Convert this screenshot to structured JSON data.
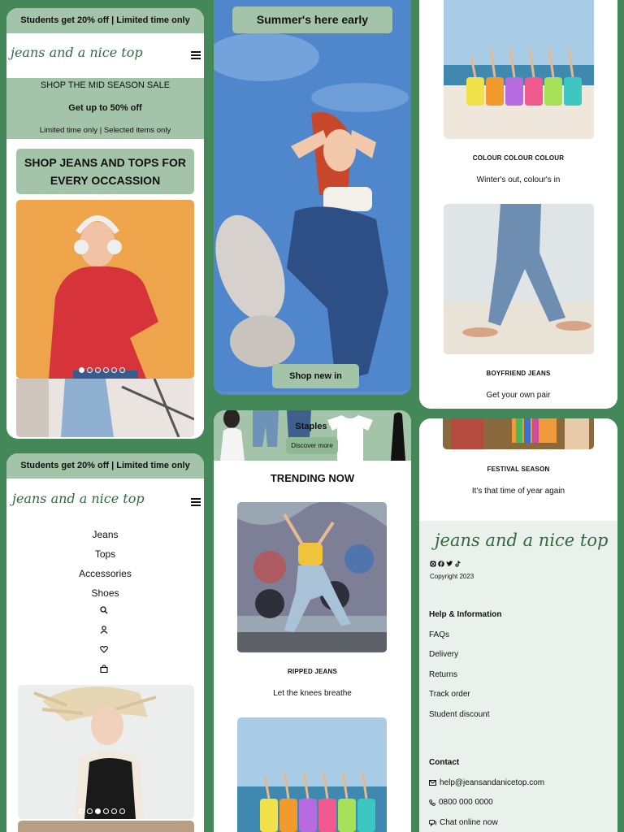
{
  "promo": "Students get 20% off | Limited time only",
  "brand": "jeans and a nice top",
  "sale": {
    "title": "SHOP THE MID SEASON SALE",
    "offer": "Get up to 50% off",
    "note": "Limited time only | Selected items only"
  },
  "hero_heading": "SHOP JEANS AND TOPS FOR EVERY OCCASSION",
  "carousel1": {
    "slides": 6,
    "active": 1
  },
  "summer": {
    "banner": "Summer's here early",
    "cta": "Shop new in"
  },
  "staples": {
    "title": "Staples",
    "cta": "Discover more"
  },
  "trending": {
    "heading": "TRENDING NOW",
    "items": [
      {
        "title": "RIPPED JEANS",
        "subtitle": "Let the knees breathe"
      }
    ]
  },
  "collections": [
    {
      "title": "COLOUR COLOUR COLOUR",
      "subtitle": "Winter's out, colour's in"
    },
    {
      "title": "BOYFRIEND JEANS",
      "subtitle": "Get your own pair"
    },
    {
      "title": "FESTIVAL SEASON",
      "subtitle": "It's that time of year again"
    }
  ],
  "menu": {
    "items": [
      "Jeans",
      "Tops",
      "Accessories",
      "Shoes"
    ],
    "icons": [
      "search-icon",
      "user-icon",
      "heart-icon",
      "bag-icon"
    ]
  },
  "carousel2": {
    "slides": 6,
    "active": 3
  },
  "footer": {
    "social_icons": [
      "instagram-icon",
      "facebook-icon",
      "twitter-icon",
      "tiktok-icon"
    ],
    "copyright": "Copyright 2023",
    "help_heading": "Help & Information",
    "help_links": [
      "FAQs",
      "Delivery",
      "Returns",
      "Track order",
      "Student discount"
    ],
    "contact_heading": "Contact",
    "email": "help@jeansandanicetop.com",
    "phone": "0800 000 0000",
    "chat": "Chat online now"
  },
  "colors": {
    "background": "#44885a",
    "accent": "#a3c4a8",
    "brand": "#2f6b3e",
    "footer_bg": "#eaf1ec"
  }
}
